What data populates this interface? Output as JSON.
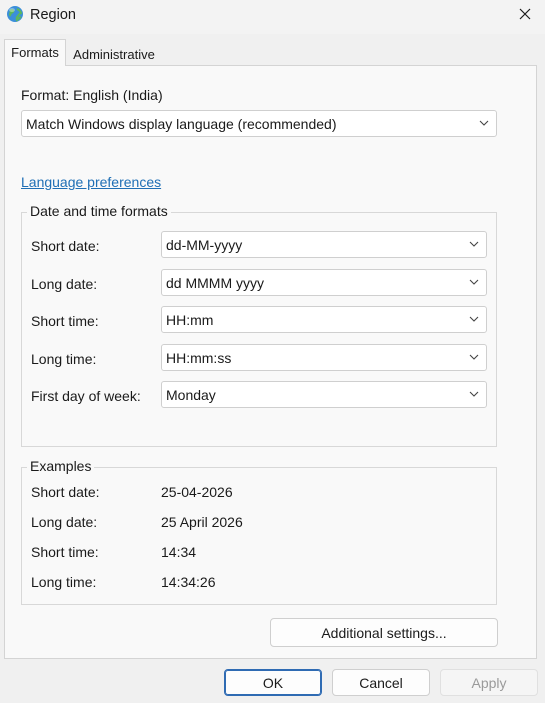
{
  "window": {
    "title": "Region",
    "icon": "globe-icon",
    "close_icon": "close-icon"
  },
  "tabs": [
    {
      "label": "Formats",
      "active": true
    },
    {
      "label": "Administrative",
      "active": false
    }
  ],
  "format": {
    "label": "Format: English (India)",
    "selected": "Match Windows display language (recommended)"
  },
  "language_preferences_link": "Language preferences",
  "date_time_formats": {
    "title": "Date and time formats",
    "rows": [
      {
        "label": "Short date:",
        "value": "dd-MM-yyyy"
      },
      {
        "label": "Long date:",
        "value": "dd MMMM yyyy"
      },
      {
        "label": "Short time:",
        "value": "HH:mm"
      },
      {
        "label": "Long time:",
        "value": "HH:mm:ss"
      },
      {
        "label": "First day of week:",
        "value": "Monday"
      }
    ]
  },
  "examples": {
    "title": "Examples",
    "rows": [
      {
        "label": "Short date:",
        "value": "25-04-2026"
      },
      {
        "label": "Long date:",
        "value": "25 April 2026"
      },
      {
        "label": "Short time:",
        "value": "14:34"
      },
      {
        "label": "Long time:",
        "value": "14:34:26"
      }
    ]
  },
  "buttons": {
    "additional_settings": "Additional settings...",
    "ok": "OK",
    "cancel": "Cancel",
    "apply": "Apply",
    "apply_enabled": false
  },
  "colors": {
    "link": "#1f6fb5",
    "primary_border": "#2f6bb3",
    "background": "#f0f0f0",
    "panel": "#f9f9f9"
  }
}
